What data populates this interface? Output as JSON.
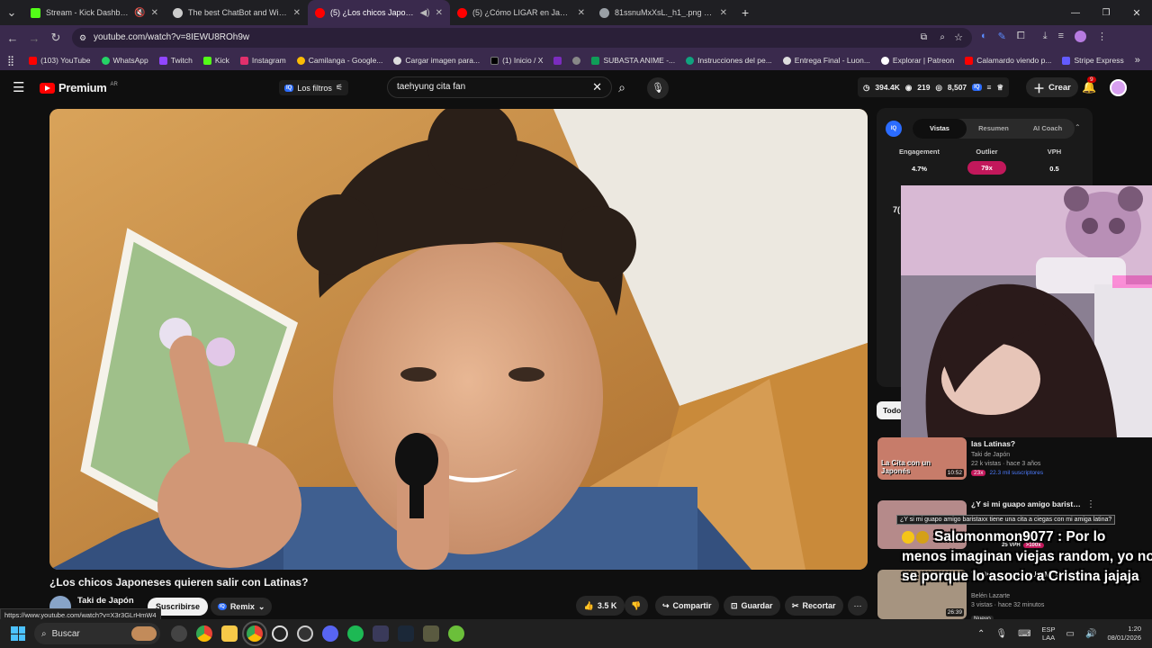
{
  "tabs": [
    {
      "title": "Stream - Kick Dashboard",
      "color": "#53fc18"
    },
    {
      "title": "The best ChatBot and Widgets",
      "color": "#cccccc"
    },
    {
      "title": "(5) ¿Los chicos Japoneses q",
      "color": "#ff0000"
    },
    {
      "title": "(5) ¿Cómo LIGAR en Japón sien",
      "color": "#ff0000"
    },
    {
      "title": "81ssnuMxXsL._h1_.png (512×5",
      "color": "#9aa0a6"
    }
  ],
  "new_tab": "+",
  "url": "youtube.com/watch?v=8IEWU8ROh9w",
  "bookmarks": [
    {
      "label": "(103) YouTube",
      "color": "#ff0000"
    },
    {
      "label": "WhatsApp",
      "color": "#25d366"
    },
    {
      "label": "Twitch",
      "color": "#9146ff"
    },
    {
      "label": "Kick",
      "color": "#53fc18"
    },
    {
      "label": "Instagram",
      "color": "#e1306c"
    },
    {
      "label": "Camilanga - Google...",
      "color": "#fbbc05"
    },
    {
      "label": "Cargar imagen para...",
      "color": "#dddddd"
    },
    {
      "label": "(1) Inicio / X",
      "color": "#000000"
    },
    {
      "label": "",
      "color": "#7b2cbf"
    },
    {
      "label": "",
      "color": "#888888"
    },
    {
      "label": "SUBASTA ANIME -...",
      "color": "#0f9d58"
    },
    {
      "label": "Instrucciones del pe...",
      "color": "#10a37f"
    },
    {
      "label": "Entrega Final - Luon...",
      "color": "#dddddd"
    },
    {
      "label": "Explorar | Patreon",
      "color": "#ffffff"
    },
    {
      "label": "Calamardo viendo p...",
      "color": "#ff0000"
    },
    {
      "label": "Stripe Express",
      "color": "#635bff"
    }
  ],
  "yt": {
    "logo": "Premium",
    "logo_sup": "AR",
    "filters": "Los filtros",
    "search_value": "taehyung cita fan",
    "stats": {
      "views": "394.4K",
      "subs": "219",
      "count": "8,507"
    },
    "create": "Crear",
    "notif": "9"
  },
  "video": {
    "title": "¿Los chicos Japoneses quieren salir con Latinas?",
    "channel": "Taki de Japón",
    "subscribe": "Suscribirse",
    "remix": "Remix",
    "likes": "3.5 K",
    "share": "Compartir",
    "save": "Guardar",
    "clip": "Recortar",
    "status_url": "https://www.youtube.com/watch?v=X3r3GLrHmW4"
  },
  "vidiq": {
    "tabs": [
      "Vistas",
      "Resumen",
      "AI Coach"
    ],
    "metrics": [
      {
        "label": "Engagement",
        "value": "4.7%"
      },
      {
        "label": "Outlier",
        "value": "79x"
      },
      {
        "label": "VPH",
        "value": "0.5"
      }
    ],
    "side_num": "7(",
    "all_chip": "Todo"
  },
  "recommended": [
    {
      "title": "las Latinas?",
      "channel": "Taki de Japón",
      "meta": "22 k vistas · hace 3 años",
      "badge": "23x",
      "badge2": "22.3 mil suscriptores",
      "duration": "10:52",
      "thumb_text": "La Cita con un Japonés"
    },
    {
      "title": "¿Y si mi guapo amigo baristaxx",
      "tooltip": "¿Y si mi guapo amigo baristaxx tiene una cita a ciegas con mi amiga latina?",
      "badge": "25 VPH",
      "badge2": ">100x"
    },
    {
      "title": "VLOG RIO #2 - SUBIMOS A LA...",
      "channel": "Belén Lazarte",
      "meta": "3 vistas · hace 32 minutos",
      "badge": "Nuevo",
      "duration": "26:39"
    }
  ],
  "chat": {
    "user": "Salomonmon9077",
    "message": ": Por lo menos imaginan viejas random, yo no se porque lo asocio a Cristina jajaja",
    "line1": "Salomonmon9077 : Por lo",
    "line2": "menos imaginan viejas random, yo no",
    "line3": "se porque lo asocio a Cristina jajaja"
  },
  "taskbar": {
    "search": "Buscar",
    "lang1": "ESP",
    "lang2": "LAA",
    "time": "1:20",
    "date": "08/01/2026"
  }
}
